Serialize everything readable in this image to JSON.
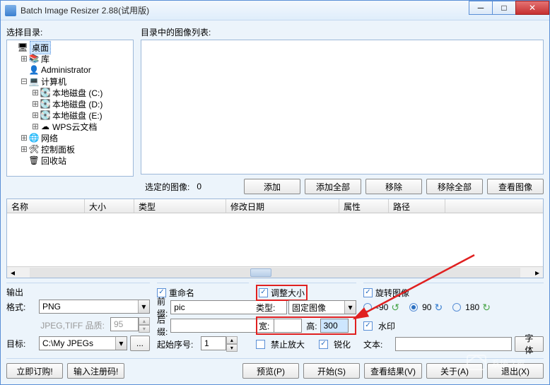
{
  "window": {
    "title": "Batch Image Resizer 2.88(试用版)"
  },
  "tree": {
    "label": "选择目录:",
    "items": [
      {
        "indent": 0,
        "tw": "",
        "icon": "🖥",
        "label": "桌面",
        "selected": true
      },
      {
        "indent": 1,
        "tw": "⊞",
        "icon": "📚",
        "label": "库"
      },
      {
        "indent": 1,
        "tw": "",
        "icon": "👤",
        "label": "Administrator"
      },
      {
        "indent": 1,
        "tw": "⊟",
        "icon": "💻",
        "label": "计算机"
      },
      {
        "indent": 2,
        "tw": "⊞",
        "icon": "💽",
        "label": "本地磁盘 (C:)"
      },
      {
        "indent": 2,
        "tw": "⊞",
        "icon": "💽",
        "label": "本地磁盘 (D:)"
      },
      {
        "indent": 2,
        "tw": "⊞",
        "icon": "💽",
        "label": "本地磁盘 (E:)"
      },
      {
        "indent": 2,
        "tw": "⊞",
        "icon": "☁",
        "label": "WPS云文档"
      },
      {
        "indent": 1,
        "tw": "⊞",
        "icon": "🌐",
        "label": "网络"
      },
      {
        "indent": 1,
        "tw": "⊞",
        "icon": "🛠",
        "label": "控制面板"
      },
      {
        "indent": 1,
        "tw": "",
        "icon": "🗑",
        "label": "回收站"
      }
    ]
  },
  "imagelist": {
    "label": "目录中的图像列表:"
  },
  "selectbar": {
    "label": "选定的图像:",
    "count": "0",
    "add": "添加",
    "addall": "添加全部",
    "remove": "移除",
    "removeall": "移除全部",
    "view": "查看图像"
  },
  "filelist": {
    "columns": [
      "名称",
      "大小",
      "类型",
      "修改日期",
      "属性",
      "路径"
    ]
  },
  "output": {
    "title": "输出",
    "format_label": "格式:",
    "format_value": "PNG",
    "quality_label": "JPEG,TIFF 品质:",
    "quality_value": "95",
    "target_label": "目标:",
    "target_value": "C:\\My JPEGs"
  },
  "rename": {
    "check": "重命名",
    "prefix_label": "前缀:",
    "prefix_value": "pic",
    "suffix_label": "后缀:",
    "suffix_value": "",
    "startno_label": "起始序号:",
    "startno_value": "1"
  },
  "resize": {
    "check": "调整大小",
    "type_label": "类型:",
    "type_value": "固定图像",
    "width_label": "宽:",
    "width_value": "",
    "height_label": "高:",
    "height_value": "300",
    "noenlarge": "禁止放大",
    "sharpen": "锐化"
  },
  "rotate": {
    "check": "旋转图像",
    "m90": "-90",
    "p90": "90",
    "p180": "180",
    "watermark": "水印",
    "text_label": "文本:",
    "text_value": "",
    "font_btn": "字体"
  },
  "footer": {
    "order": "立即订购!",
    "regcode": "输入注册码!",
    "preview": "预览(P)",
    "start": "开始(S)",
    "viewresult": "查看结果(V)",
    "about": "关于(A)",
    "exit": "退出(X)"
  },
  "watermark_text": "系统之家"
}
